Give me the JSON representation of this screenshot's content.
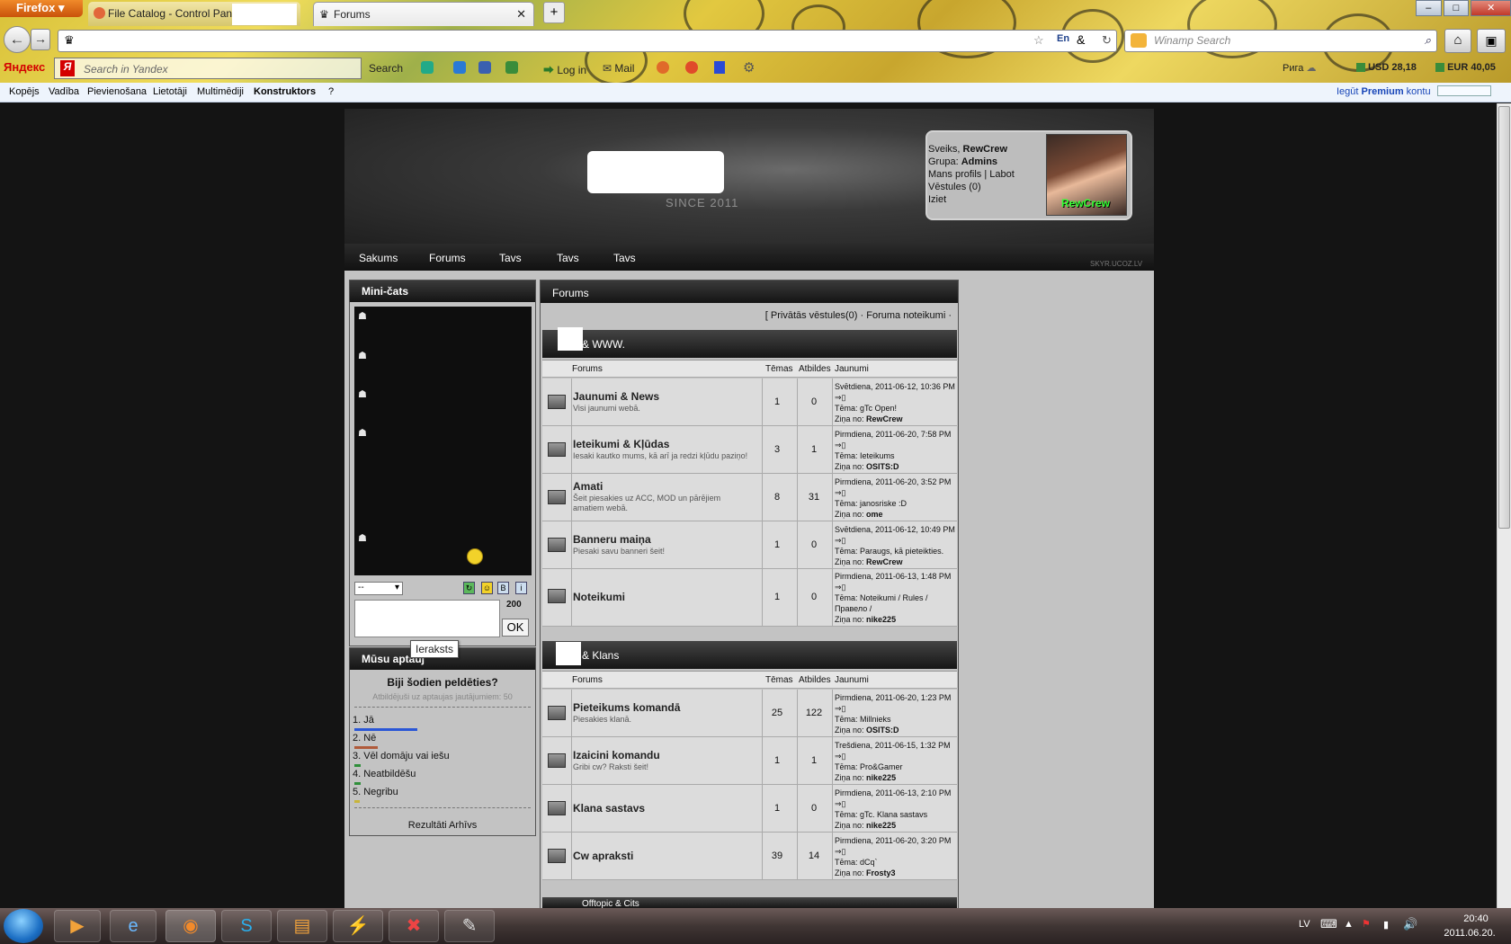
{
  "browser": {
    "menu_button": "Firefox",
    "tabs": [
      {
        "label": "File Catalog - Control Pan"
      },
      {
        "label": "Forums"
      }
    ],
    "window_buttons": {
      "minimize": "–",
      "maximize": "□",
      "close": "✕"
    },
    "search_placeholder": "Winamp Search",
    "yandex": {
      "logo": "Яндекс",
      "placeholder": "Search in Yandex",
      "search_label": "Search",
      "login": "Log in",
      "mail": "Mail",
      "weather": "Рига",
      "usd": "USD 28,18",
      "eur": "EUR 40,05"
    }
  },
  "ucoz_bar": {
    "items": [
      "Kopējs",
      "Vadība",
      "Pievienošana",
      "Lietotāji",
      "Multimēdiji",
      "Konstruktors",
      "?"
    ],
    "premium_prefix": "Iegūt",
    "premium": "Premium",
    "premium_suffix": "kontu"
  },
  "site": {
    "since": "SINCE 2011",
    "user": {
      "greeting": "Sveiks,",
      "name": "RewCrew",
      "group_label": "Grupa:",
      "group": "Admins",
      "profile": "Mans profils | Labot",
      "messages": "Vēstules (0)",
      "logout": "Iziet",
      "avatar_text": "RewCrew"
    },
    "nav": [
      "Sakums",
      "Forums",
      "Tavs",
      "Tavs",
      "Tavs"
    ],
    "footer_url": "SKYR.UCOZ.LV"
  },
  "minichat": {
    "title": "Mini-čats",
    "select": "--",
    "counter": "200",
    "ok": "OK",
    "tooltip": "Ieraksts"
  },
  "poll": {
    "title": "Mūsu aptauj",
    "question": "Biji šodien peldēties?",
    "answered": "Atbildējuši uz aptaujas jautājumiem: 50",
    "options": [
      {
        "label": "1. Jā",
        "color": "#2a56d6",
        "fraction": 0.58
      },
      {
        "label": "2. Nē",
        "color": "#b05a3a",
        "fraction": 0.22
      },
      {
        "label": "3. Vēl domāju vai iešu",
        "color": "#2f8f3a",
        "fraction": 0.06
      },
      {
        "label": "4. Neatbildēšu",
        "color": "#2f8f3a",
        "fraction": 0.06
      },
      {
        "label": "5. Negribu",
        "color": "#c8b43a",
        "fraction": 0.04
      }
    ],
    "links": "Rezultāti Arhīvs"
  },
  "forum": {
    "title": "Forums",
    "top_links": "[ Privātās vēstules(0) · Foruma noteikumi ·",
    "headers": {
      "forums": "Forums",
      "topics": "Tēmas",
      "replies": "Atbildes",
      "latest": "Jaunumi"
    },
    "categories": [
      {
        "name": "& WWW.",
        "rows": [
          {
            "title": "Jaunumi & News",
            "desc": "Visi jaunumi webā.",
            "topics": "1",
            "replies": "0",
            "date": "Svētdiena, 2011-06-12, 10:36 PM",
            "topic_label": "Tēma:",
            "topic": "gTc Open!",
            "by_label": "Ziņa no:",
            "by": "RewCrew"
          },
          {
            "title": "Ieteikumi & Kļūdas",
            "desc": "Iesaki kautko mums, kā arī ja redzi kļūdu paziņo!",
            "topics": "3",
            "replies": "1",
            "date": "Pirmdiena, 2011-06-20, 7:58 PM",
            "topic_label": "Tēma:",
            "topic": "Ieteikums",
            "by_label": "Ziņa no:",
            "by": "OSITS:D"
          },
          {
            "title": "Amati",
            "desc": "Šeit piesakies uz ACC, MOD un pārējiem amatiem webā.",
            "topics": "8",
            "replies": "31",
            "date": "Pirmdiena, 2011-06-20, 3:52 PM",
            "topic_label": "Tēma:",
            "topic": "janosriske :D",
            "by_label": "Ziņa no:",
            "by": "ome"
          },
          {
            "title": "Banneru maiņa",
            "desc": "Piesaki savu banneri šeit!",
            "topics": "1",
            "replies": "0",
            "date": "Svētdiena, 2011-06-12, 10:49 PM",
            "topic_label": "Tēma:",
            "topic": "Paraugs, kā pieteikties.",
            "by_label": "Ziņa no:",
            "by": "RewCrew"
          },
          {
            "title": "Noteikumi",
            "desc": "",
            "topics": "1",
            "replies": "0",
            "date": "Pirmdiena, 2011-06-13, 1:48 PM",
            "topic_label": "Tēma:",
            "topic": "Noteikumi / Rules / Правело /",
            "by_label": "Ziņa no:",
            "by": "nike225"
          }
        ]
      },
      {
        "name": "& Klans",
        "rows": [
          {
            "title": "Pieteikums komandā",
            "desc": "Piesakies klanā.",
            "topics": "25",
            "replies": "122",
            "date": "Pirmdiena, 2011-06-20, 1:23 PM",
            "topic_label": "Tēma:",
            "topic": "Millnieks",
            "by_label": "Ziņa no:",
            "by": "OSITS:D"
          },
          {
            "title": "Izaicini komandu",
            "desc": "Gribi cw? Raksti šeit!",
            "topics": "1",
            "replies": "1",
            "date": "Trešdiena, 2011-06-15, 1:32 PM",
            "topic_label": "Tēma:",
            "topic": "Pro&Gamer",
            "by_label": "Ziņa no:",
            "by": "nike225"
          },
          {
            "title": "Klana sastavs",
            "desc": "",
            "topics": "1",
            "replies": "0",
            "date": "Pirmdiena, 2011-06-13, 2:10 PM",
            "topic_label": "Tēma:",
            "topic": "gTc. Klana sastavs",
            "by_label": "Ziņa no:",
            "by": "nike225"
          },
          {
            "title": "Cw apraksti",
            "desc": "",
            "topics": "39",
            "replies": "14",
            "date": "Pirmdiena, 2011-06-20, 3:20 PM",
            "topic_label": "Tēma:",
            "topic": "dCq`",
            "by_label": "Ziņa no:",
            "by": "Frosty3"
          }
        ]
      }
    ],
    "next_category": "Offtopic & Cits"
  },
  "taskbar": {
    "lang": "LV",
    "time": "20:40",
    "date": "2011.06.20."
  }
}
